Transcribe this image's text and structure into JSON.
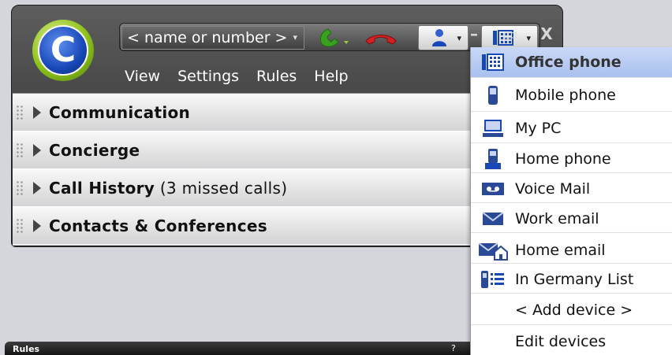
{
  "toolbar": {
    "name_placeholder": "< name or number >",
    "combo_arrow": "▾",
    "button_arrow": "▾"
  },
  "window_controls": {
    "minimize": "–",
    "maximize": "▭",
    "close": "X"
  },
  "logo_letter": "C",
  "menu": {
    "view": "View",
    "settings": "Settings",
    "rules": "Rules",
    "help": "Help"
  },
  "sections": [
    {
      "title": "Communication",
      "sub": ""
    },
    {
      "title": "Concierge",
      "sub": ""
    },
    {
      "title": "Call History",
      "sub": " (3 missed calls)"
    },
    {
      "title": "Contacts & Conferences",
      "sub": ""
    }
  ],
  "taskstrip": {
    "title": "Rules",
    "help": "?"
  },
  "dropdown": {
    "items": [
      {
        "label": "Office phone",
        "icon": "office-phone-icon"
      },
      {
        "label": "Mobile phone",
        "icon": "mobile-phone-icon"
      },
      {
        "label": "My PC",
        "icon": "pc-icon"
      },
      {
        "label": "Home phone",
        "icon": "home-phone-icon"
      },
      {
        "label": "Voice Mail",
        "icon": "voicemail-icon"
      },
      {
        "label": "Work email",
        "icon": "work-email-icon"
      },
      {
        "label": "Home email",
        "icon": "home-email-icon"
      },
      {
        "label": "In Germany List",
        "icon": "device-list-icon"
      },
      {
        "label": "< Add device >",
        "icon": ""
      },
      {
        "label": "Edit devices",
        "icon": ""
      }
    ]
  },
  "colors": {
    "accent": "#1848b8",
    "call_green": "#3aa020",
    "hangup_red": "#d42020",
    "selection": "#b9ccf2"
  }
}
